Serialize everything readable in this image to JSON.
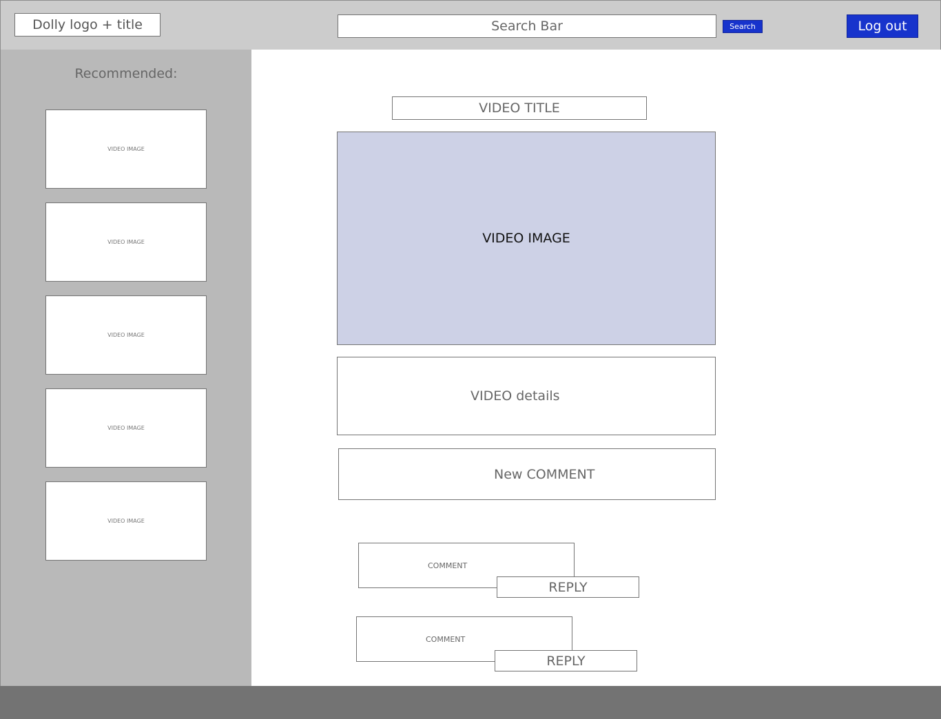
{
  "header": {
    "logo_label": "Dolly logo + title",
    "search_placeholder": "Search Bar",
    "search_button": "Search",
    "logout_button": "Log out"
  },
  "sidebar": {
    "title": "Recommended:",
    "thumbnails": [
      {
        "label": "VIDEO IMAGE"
      },
      {
        "label": "VIDEO IMAGE"
      },
      {
        "label": "VIDEO IMAGE"
      },
      {
        "label": "VIDEO IMAGE"
      },
      {
        "label": "VIDEO IMAGE"
      }
    ]
  },
  "main": {
    "video_title": "VIDEO TITLE",
    "video_image": "VIDEO IMAGE",
    "video_details": "VIDEO details",
    "new_comment": "New COMMENT",
    "comments": [
      {
        "text": "COMMENT",
        "reply": "REPLY"
      },
      {
        "text": "COMMENT",
        "reply": "REPLY"
      }
    ]
  },
  "colors": {
    "accent_blue": "#1733cc",
    "header_bg": "#cccccc",
    "sidebar_bg": "#b9b9b9",
    "video_bg": "#cdd1e6",
    "footer_bg": "#737373"
  }
}
